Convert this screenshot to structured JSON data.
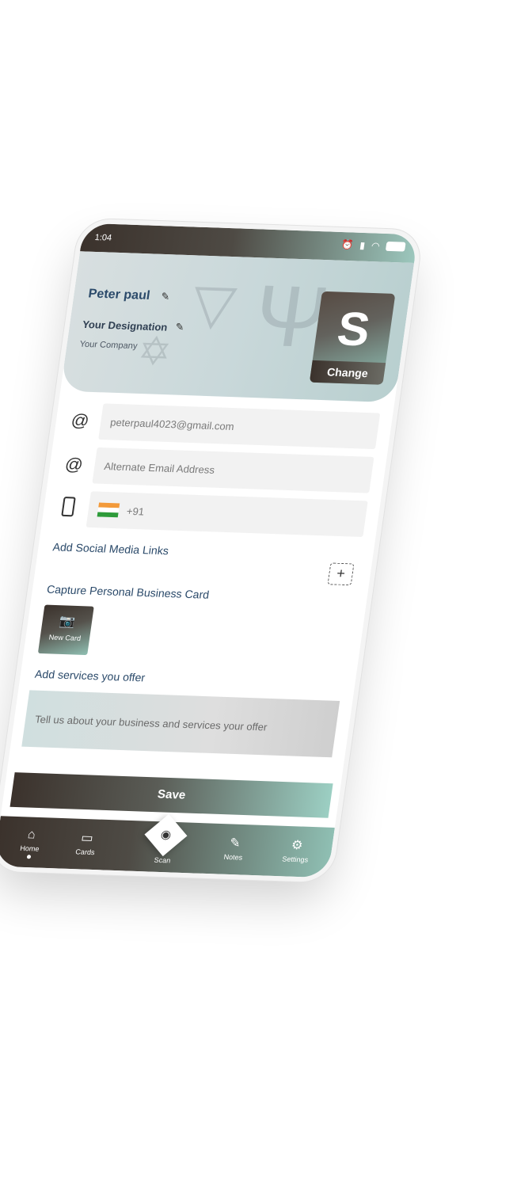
{
  "status": {
    "time": "1:04"
  },
  "profile": {
    "name": "Peter paul",
    "designation": "Your Designation",
    "company": "Your Company",
    "logo_letter": "S",
    "change_label": "Change"
  },
  "contact": {
    "email_value": "peterpaul4023@gmail.com",
    "alt_email_placeholder": "Alternate Email Address",
    "phone_code": "+91"
  },
  "sections": {
    "social_label": "Add Social Media Links",
    "capture_label": "Capture Personal Business Card",
    "new_card_label": "New Card",
    "services_label": "Add services you offer",
    "services_placeholder": "Tell us about your business and services your offer"
  },
  "save_label": "Save",
  "nav": {
    "items": [
      {
        "label": "Home",
        "icon": "home-icon"
      },
      {
        "label": "Cards",
        "icon": "cards-icon"
      },
      {
        "label": "Scan",
        "icon": "camera-icon"
      },
      {
        "label": "Notes",
        "icon": "notes-icon"
      },
      {
        "label": "Settings",
        "icon": "settings-icon"
      }
    ]
  },
  "colors": {
    "accent_dark": "#3b322c",
    "accent_teal": "#9cc7bd",
    "label_blue": "#2b4a6a"
  }
}
